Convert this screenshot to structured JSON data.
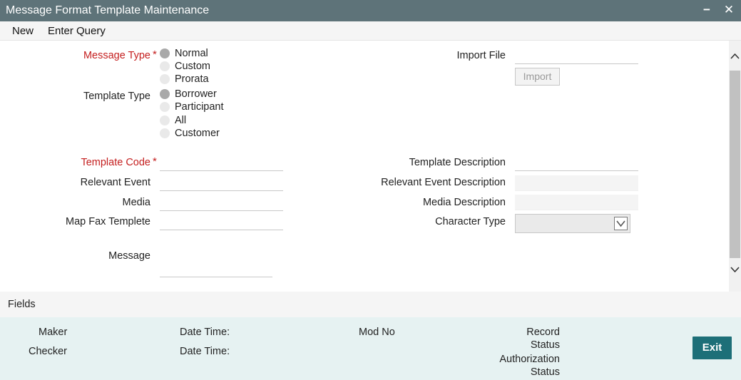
{
  "window": {
    "title": "Message Format Template Maintenance",
    "minimize_glyph": "−",
    "close_glyph": "✕"
  },
  "menu": {
    "new_label": "New",
    "enter_query_label": "Enter Query"
  },
  "form": {
    "required_marker": "*",
    "message_type": {
      "label": "Message Type",
      "options": [
        "Normal",
        "Custom",
        "Prorata"
      ],
      "selected": "Normal"
    },
    "template_type": {
      "label": "Template Type",
      "options": [
        "Borrower",
        "Participant",
        "All",
        "Customer"
      ],
      "selected": "Borrower"
    },
    "import_file": {
      "label": "Import File",
      "value": "",
      "button_label": "Import"
    },
    "template_code": {
      "label": "Template Code",
      "value": ""
    },
    "template_description": {
      "label": "Template Description",
      "value": ""
    },
    "relevant_event": {
      "label": "Relevant Event",
      "value": ""
    },
    "relevant_event_description": {
      "label": "Relevant Event Description",
      "value": ""
    },
    "media": {
      "label": "Media",
      "value": ""
    },
    "media_description": {
      "label": "Media Description",
      "value": ""
    },
    "map_fax_template": {
      "label": "Map Fax Templete",
      "value": ""
    },
    "character_type": {
      "label": "Character Type",
      "value": ""
    },
    "message": {
      "label": "Message",
      "value": ""
    }
  },
  "fields_section": {
    "label": "Fields"
  },
  "footer": {
    "maker_label": "Maker",
    "checker_label": "Checker",
    "date_time_label": "Date Time:",
    "mod_no_label": "Mod No",
    "record_status_line1": "Record",
    "record_status_line2": "Status",
    "authorization_status_line1": "Authorization",
    "authorization_status_line2": "Status",
    "exit_label": "Exit"
  },
  "colors": {
    "title_bar": "#5e7379",
    "required_label": "#c41e1e",
    "footer_bg": "#e6f2f2",
    "exit_button": "#1d6f78"
  }
}
